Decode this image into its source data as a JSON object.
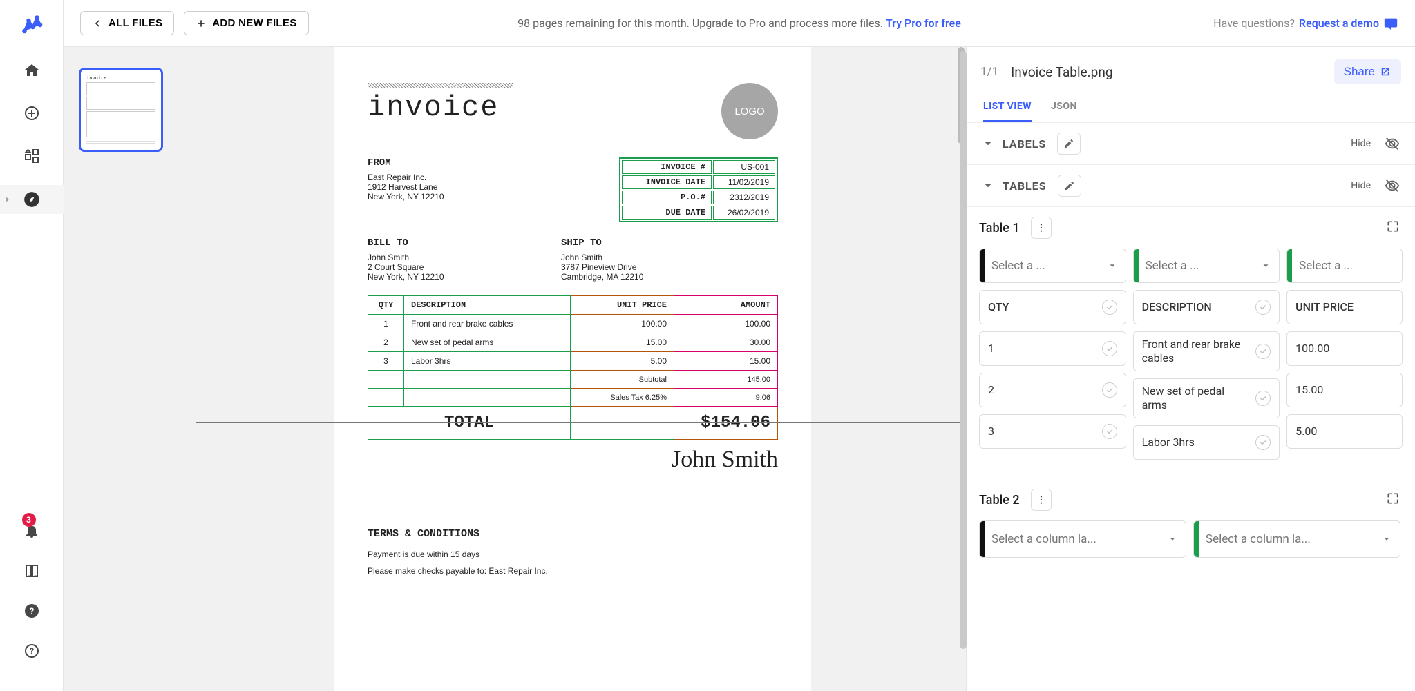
{
  "topbar": {
    "all_files": "ALL FILES",
    "add_new": "ADD NEW FILES",
    "promo_prefix": "98 pages remaining for this month. Upgrade to Pro and process more files. ",
    "promo_link": "Try Pro for free",
    "help_prefix": "Have questions? ",
    "help_link": "Request a demo"
  },
  "sidebar": {
    "notif_count": "3"
  },
  "doc": {
    "title": "invoice",
    "logo_text": "LOGO",
    "from_label": "FROM",
    "from_name": "East Repair Inc.",
    "from_l1": "1912 Harvest Lane",
    "from_l2": "New York, NY 12210",
    "meta": {
      "inv_no_label": "INVOICE #",
      "inv_no": "US-001",
      "inv_date_label": "INVOICE DATE",
      "inv_date": "11/02/2019",
      "po_label": "P.O.#",
      "po": "2312/2019",
      "due_label": "DUE DATE",
      "due": "26/02/2019"
    },
    "bill_label": "BILL TO",
    "ship_label": "SHIP TO",
    "bill_name": "John Smith",
    "bill_l1": "2 Court Square",
    "bill_l2": "New York, NY 12210",
    "ship_name": "John Smith",
    "ship_l1": "3787 Pineview Drive",
    "ship_l2": "Cambridge, MA 12210",
    "cols": {
      "qty": "QTY",
      "desc": "DESCRIPTION",
      "unit": "UNIT PRICE",
      "amt": "AMOUNT"
    },
    "rows": [
      {
        "q": "1",
        "d": "Front and rear brake cables",
        "u": "100.00",
        "a": "100.00"
      },
      {
        "q": "2",
        "d": "New set of pedal arms",
        "u": "15.00",
        "a": "30.00"
      },
      {
        "q": "3",
        "d": "Labor 3hrs",
        "u": "5.00",
        "a": "15.00"
      }
    ],
    "subtotal_label": "Subtotal",
    "subtotal": "145.00",
    "tax_label": "Sales Tax 6.25%",
    "tax": "9.06",
    "total_label": "TOTAL",
    "total": "$154.06",
    "signature": "John Smith",
    "terms_label": "TERMS & CONDITIONS",
    "terms_l1": "Payment is due within 15 days",
    "terms_l2": "Please make checks payable to: East Repair Inc."
  },
  "rp": {
    "page_count": "1/1",
    "filename": "Invoice Table.png",
    "share": "Share",
    "tabs": {
      "list": "LIST VIEW",
      "json": "JSON"
    },
    "sections": {
      "labels": "LABELS",
      "tables": "TABLES",
      "hide": "Hide"
    },
    "table1": {
      "name": "Table 1",
      "select_short": "Select a ...",
      "header": {
        "c1": "QTY",
        "c2": "DESCRIPTION",
        "c3": "UNIT PRICE"
      },
      "r1": {
        "c1": "1",
        "c2": "Front and rear brake cables",
        "c3": "100.00"
      },
      "r2": {
        "c1": "2",
        "c2": "New set of pedal arms",
        "c3": "15.00"
      },
      "r3": {
        "c1": "3",
        "c2": "Labor 3hrs",
        "c3": "5.00"
      }
    },
    "table2": {
      "name": "Table 2",
      "select_long": "Select a column la..."
    }
  }
}
